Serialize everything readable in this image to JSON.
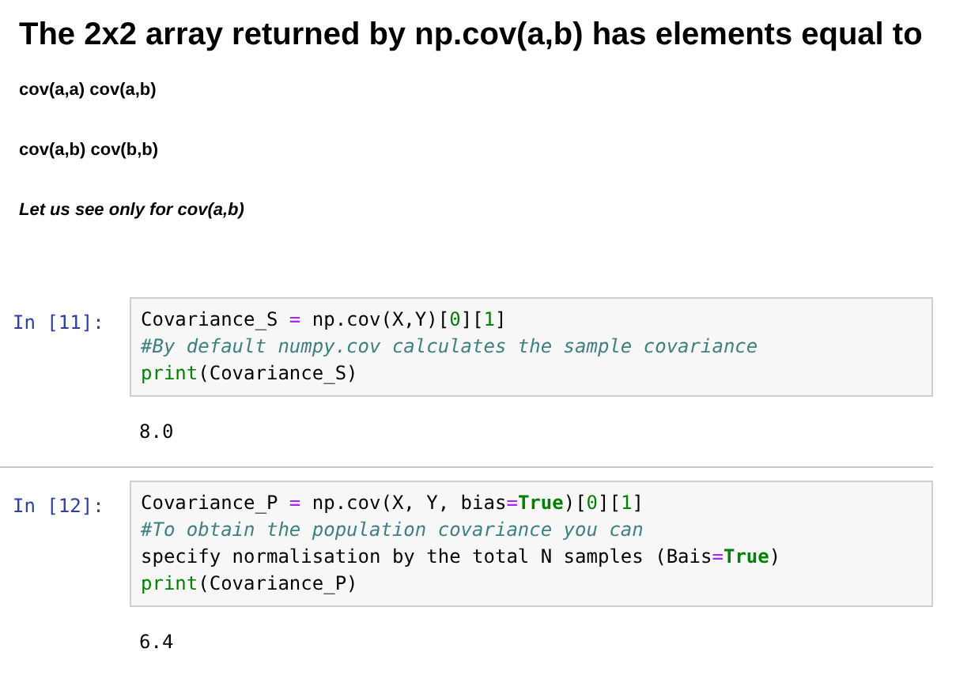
{
  "heading": "The 2x2 array returned by np.cov(a,b) has elements equal to",
  "paragraphs": [
    {
      "text": "cov(a,a) cov(a,b)",
      "italic": false
    },
    {
      "text": "cov(a,b) cov(b,b)",
      "italic": false
    },
    {
      "text": "Let us see only for cov(a,b)",
      "italic": true
    }
  ],
  "cells": [
    {
      "prompt": "In [11]:",
      "lines": [
        [
          {
            "kind": "plain",
            "text": "Covariance_S "
          },
          {
            "kind": "op",
            "text": "="
          },
          {
            "kind": "plain",
            "text": " np.cov(X,Y)["
          },
          {
            "kind": "num",
            "text": "0"
          },
          {
            "kind": "plain",
            "text": "]["
          },
          {
            "kind": "num",
            "text": "1"
          },
          {
            "kind": "plain",
            "text": "]"
          }
        ],
        [
          {
            "kind": "comment",
            "text": "#By default numpy.cov calculates the sample covariance"
          }
        ],
        [
          {
            "kind": "builtin",
            "text": "print"
          },
          {
            "kind": "plain",
            "text": "(Covariance_S)"
          }
        ]
      ],
      "output": "8.0"
    },
    {
      "prompt": "In [12]:",
      "lines": [
        [
          {
            "kind": "plain",
            "text": "Covariance_P "
          },
          {
            "kind": "op",
            "text": "="
          },
          {
            "kind": "plain",
            "text": " np.cov(X, Y, bias"
          },
          {
            "kind": "op",
            "text": "="
          },
          {
            "kind": "kw",
            "text": "True"
          },
          {
            "kind": "plain",
            "text": ")["
          },
          {
            "kind": "num",
            "text": "0"
          },
          {
            "kind": "plain",
            "text": "]["
          },
          {
            "kind": "num",
            "text": "1"
          },
          {
            "kind": "plain",
            "text": "]"
          }
        ],
        [
          {
            "kind": "comment",
            "text": "#To obtain the population covariance you can"
          }
        ],
        [
          {
            "kind": "plain",
            "text": "specify normalisation by the total N samples (Bais"
          },
          {
            "kind": "op",
            "text": "="
          },
          {
            "kind": "kw",
            "text": "True"
          },
          {
            "kind": "plain",
            "text": ")"
          }
        ],
        [
          {
            "kind": "builtin",
            "text": "print"
          },
          {
            "kind": "plain",
            "text": "(Covariance_P)"
          }
        ]
      ],
      "output": "6.4"
    }
  ]
}
